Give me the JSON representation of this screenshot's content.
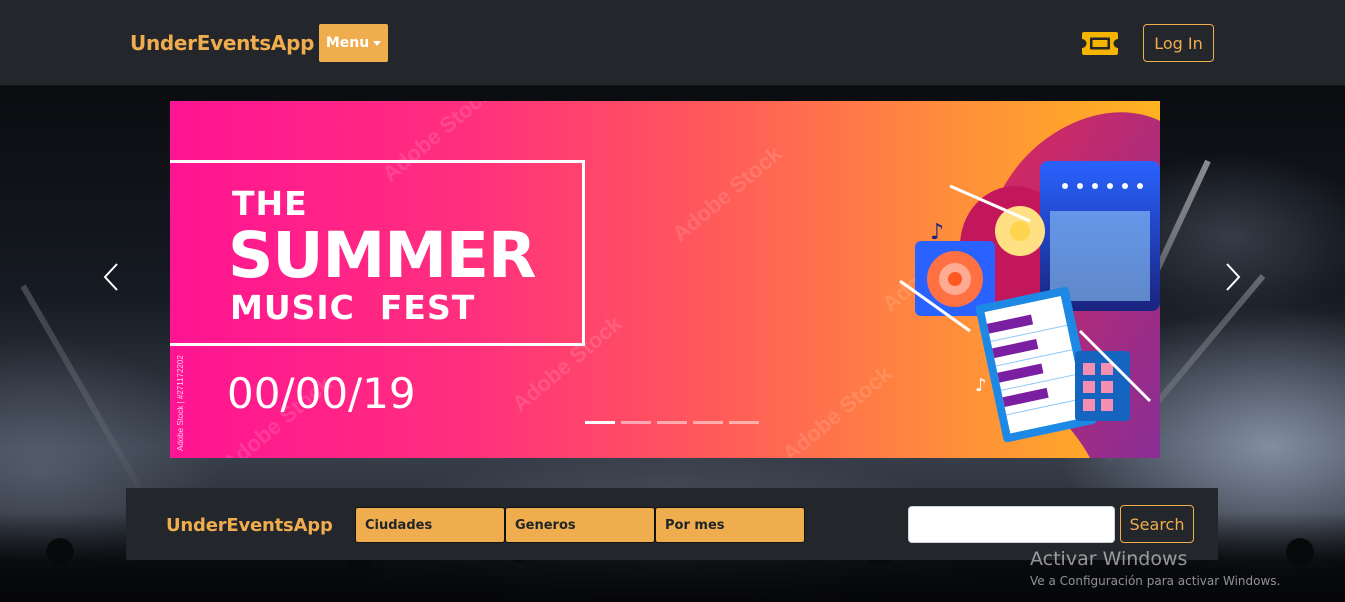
{
  "navbar": {
    "brand": "UnderEventsApp",
    "menu_label": "Menu",
    "ticket_icon": "ticket-icon",
    "login_label": "Log In"
  },
  "carousel": {
    "slide": {
      "line1": "THE",
      "line2": "SUMMER",
      "line3": "MUSIC  FEST",
      "date": "00/00/19",
      "credit": "Adobe Stock | #271172202",
      "watermark": "Adobe Stock"
    },
    "indicator_count": 5,
    "active_indicator": 0,
    "prev_icon": "chevron-left-icon",
    "next_icon": "chevron-right-icon"
  },
  "filterbar": {
    "brand": "UnderEventsApp",
    "filters": [
      "Ciudades",
      "Generos",
      "Por mes"
    ],
    "search_value": "",
    "search_label": "Search"
  },
  "system_overlay": {
    "title": "Activar Windows",
    "subtitle": "Ve a Configuración para activar Windows."
  },
  "colors": {
    "accent": "#f0ad4e",
    "navbar_bg": "#23262b",
    "slide_gradient_start": "#ff1493",
    "slide_gradient_end": "#ffb420"
  }
}
